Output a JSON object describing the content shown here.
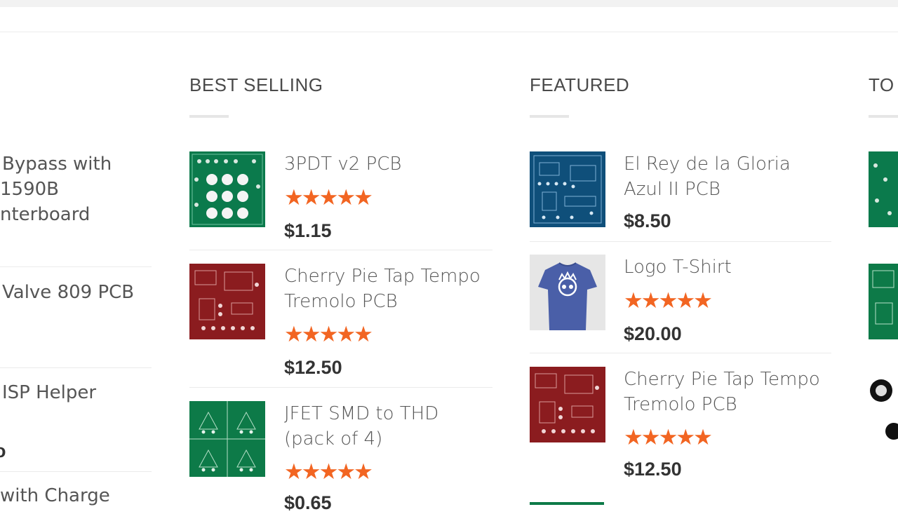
{
  "left_column": {
    "items": [
      {
        "lines": [
          "Bypass with",
          "1590B",
          "nterboard"
        ]
      },
      {
        "lines": [
          "Valve 809 PCB"
        ]
      },
      {
        "lines": [
          "ISP Helper"
        ],
        "extra": "o"
      },
      {
        "lines": [
          "with Charge"
        ]
      }
    ]
  },
  "best_selling": {
    "title": "BEST SELLING",
    "items": [
      {
        "name": "3PDT v2 PCB",
        "stars": "★★★★★",
        "price": "$1.15",
        "pcb_color": "#0b7a4c"
      },
      {
        "name": "Cherry Pie Tap Tempo Tremolo PCB",
        "stars": "★★★★★",
        "price": "$12.50",
        "pcb_color": "#8b1c1f"
      },
      {
        "name": "JFET SMD to THD (pack of 4)",
        "stars": "★★★★★",
        "price": "$0.65",
        "pcb_color": "#0d7a48"
      }
    ]
  },
  "featured": {
    "title": "FEATURED",
    "items": [
      {
        "name": "El Rey de la Gloria Azul II PCB",
        "stars": "",
        "price": "$8.50",
        "pcb_color": "#0f4f7a"
      },
      {
        "name": "Logo T-Shirt",
        "stars": "★★★★★",
        "price": "$20.00",
        "shirt_color": "#4a5fa8"
      },
      {
        "name": "Cherry Pie Tap Tempo Tremolo PCB",
        "stars": "★★★★★",
        "price": "$12.50",
        "pcb_color": "#8b1c1f"
      }
    ]
  },
  "top_rated": {
    "title": "TO"
  },
  "colors": {
    "star": "#f26522",
    "accent_line": "#e6e6e6"
  }
}
